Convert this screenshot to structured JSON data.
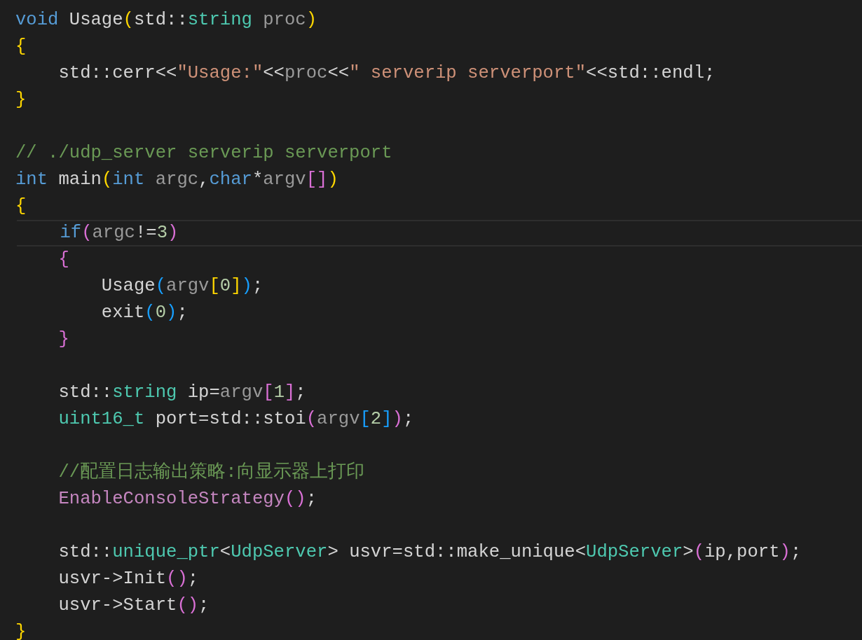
{
  "editor": {
    "lines": [
      {
        "current": false,
        "tokens": [
          {
            "text": "void",
            "color": "#569cd6"
          },
          {
            "text": " Usage",
            "color": "#d4d4d4"
          },
          {
            "text": "(",
            "color": "#ffd700"
          },
          {
            "text": "std::",
            "color": "#d4d4d4"
          },
          {
            "text": "string",
            "color": "#4ec9b0"
          },
          {
            "text": " proc",
            "color": "#9a9a9a"
          },
          {
            "text": ")",
            "color": "#ffd700"
          }
        ]
      },
      {
        "current": false,
        "tokens": [
          {
            "text": "{",
            "color": "#ffd700"
          }
        ]
      },
      {
        "current": false,
        "tokens": [
          {
            "text": "    std::cerr<<",
            "color": "#d4d4d4"
          },
          {
            "text": "\"Usage:\"",
            "color": "#ce9178"
          },
          {
            "text": "<<",
            "color": "#d4d4d4"
          },
          {
            "text": "proc",
            "color": "#9a9a9a"
          },
          {
            "text": "<<",
            "color": "#d4d4d4"
          },
          {
            "text": "\" serverip serverport\"",
            "color": "#ce9178"
          },
          {
            "text": "<<std::endl;",
            "color": "#d4d4d4"
          }
        ]
      },
      {
        "current": false,
        "tokens": [
          {
            "text": "}",
            "color": "#ffd700"
          }
        ]
      },
      {
        "current": false
      },
      {
        "current": false,
        "tokens": [
          {
            "text": "// ./udp_server serverip serverport",
            "color": "#6a9955"
          }
        ]
      },
      {
        "current": false,
        "tokens": [
          {
            "text": "int",
            "color": "#569cd6"
          },
          {
            "text": " main",
            "color": "#d4d4d4"
          },
          {
            "text": "(",
            "color": "#ffd700"
          },
          {
            "text": "int",
            "color": "#569cd6"
          },
          {
            "text": " argc",
            "color": "#9a9a9a"
          },
          {
            "text": ",",
            "color": "#d4d4d4"
          },
          {
            "text": "char",
            "color": "#569cd6"
          },
          {
            "text": "*",
            "color": "#d4d4d4"
          },
          {
            "text": "argv",
            "color": "#9a9a9a"
          },
          {
            "text": "[]",
            "color": "#da70d6"
          },
          {
            "text": ")",
            "color": "#ffd700"
          }
        ]
      },
      {
        "current": false,
        "tokens": [
          {
            "text": "{",
            "color": "#ffd700"
          }
        ]
      },
      {
        "current": true,
        "tokens": [
          {
            "text": "    if",
            "color": "#569cd6"
          },
          {
            "text": "(",
            "color": "#da70d6"
          },
          {
            "text": "argc",
            "color": "#9a9a9a"
          },
          {
            "text": "!=",
            "color": "#d4d4d4"
          },
          {
            "text": "3",
            "color": "#b5cea8"
          },
          {
            "text": ")",
            "color": "#da70d6"
          }
        ]
      },
      {
        "current": false,
        "tokens": [
          {
            "text": "    {",
            "color": "#da70d6"
          }
        ]
      },
      {
        "current": false,
        "tokens": [
          {
            "text": "        Usage",
            "color": "#d4d4d4"
          },
          {
            "text": "(",
            "color": "#179fff"
          },
          {
            "text": "argv",
            "color": "#9a9a9a"
          },
          {
            "text": "[",
            "color": "#ffd700"
          },
          {
            "text": "0",
            "color": "#b5cea8"
          },
          {
            "text": "]",
            "color": "#ffd700"
          },
          {
            "text": ")",
            "color": "#179fff"
          },
          {
            "text": ";",
            "color": "#d4d4d4"
          }
        ]
      },
      {
        "current": false,
        "tokens": [
          {
            "text": "        exit",
            "color": "#d4d4d4"
          },
          {
            "text": "(",
            "color": "#179fff"
          },
          {
            "text": "0",
            "color": "#b5cea8"
          },
          {
            "text": ")",
            "color": "#179fff"
          },
          {
            "text": ";",
            "color": "#d4d4d4"
          }
        ]
      },
      {
        "current": false,
        "tokens": [
          {
            "text": "    }",
            "color": "#da70d6"
          }
        ]
      },
      {
        "current": false
      },
      {
        "current": false,
        "tokens": [
          {
            "text": "    std::",
            "color": "#d4d4d4"
          },
          {
            "text": "string",
            "color": "#4ec9b0"
          },
          {
            "text": " ip=",
            "color": "#d4d4d4"
          },
          {
            "text": "argv",
            "color": "#9a9a9a"
          },
          {
            "text": "[",
            "color": "#da70d6"
          },
          {
            "text": "1",
            "color": "#b5cea8"
          },
          {
            "text": "]",
            "color": "#da70d6"
          },
          {
            "text": ";",
            "color": "#d4d4d4"
          }
        ]
      },
      {
        "current": false,
        "tokens": [
          {
            "text": "    uint16_t",
            "color": "#4ec9b0"
          },
          {
            "text": " port=std::stoi",
            "color": "#d4d4d4"
          },
          {
            "text": "(",
            "color": "#da70d6"
          },
          {
            "text": "argv",
            "color": "#9a9a9a"
          },
          {
            "text": "[",
            "color": "#179fff"
          },
          {
            "text": "2",
            "color": "#b5cea8"
          },
          {
            "text": "]",
            "color": "#179fff"
          },
          {
            "text": ")",
            "color": "#da70d6"
          },
          {
            "text": ";",
            "color": "#d4d4d4"
          }
        ]
      },
      {
        "current": false
      },
      {
        "current": false,
        "tokens": [
          {
            "text": "    //配置日志输出策略:向显示器上打印",
            "color": "#6a9955"
          }
        ]
      },
      {
        "current": false,
        "tokens": [
          {
            "text": "    EnableConsoleStrategy",
            "color": "#c586c0"
          },
          {
            "text": "()",
            "color": "#da70d6"
          },
          {
            "text": ";",
            "color": "#d4d4d4"
          }
        ]
      },
      {
        "current": false
      },
      {
        "current": false,
        "tokens": [
          {
            "text": "    std::",
            "color": "#d4d4d4"
          },
          {
            "text": "unique_ptr",
            "color": "#4ec9b0"
          },
          {
            "text": "<",
            "color": "#d4d4d4"
          },
          {
            "text": "UdpServer",
            "color": "#4ec9b0"
          },
          {
            "text": "> usvr=std::make_unique<",
            "color": "#d4d4d4"
          },
          {
            "text": "UdpServer",
            "color": "#4ec9b0"
          },
          {
            "text": ">",
            "color": "#d4d4d4"
          },
          {
            "text": "(",
            "color": "#da70d6"
          },
          {
            "text": "ip,port",
            "color": "#d4d4d4"
          },
          {
            "text": ")",
            "color": "#da70d6"
          },
          {
            "text": ";",
            "color": "#d4d4d4"
          }
        ]
      },
      {
        "current": false,
        "tokens": [
          {
            "text": "    usvr->Init",
            "color": "#d4d4d4"
          },
          {
            "text": "()",
            "color": "#da70d6"
          },
          {
            "text": ";",
            "color": "#d4d4d4"
          }
        ]
      },
      {
        "current": false,
        "tokens": [
          {
            "text": "    usvr->Start",
            "color": "#d4d4d4"
          },
          {
            "text": "()",
            "color": "#da70d6"
          },
          {
            "text": ";",
            "color": "#d4d4d4"
          }
        ]
      },
      {
        "current": false,
        "tokens": [
          {
            "text": "}",
            "color": "#ffd700"
          }
        ]
      }
    ]
  }
}
